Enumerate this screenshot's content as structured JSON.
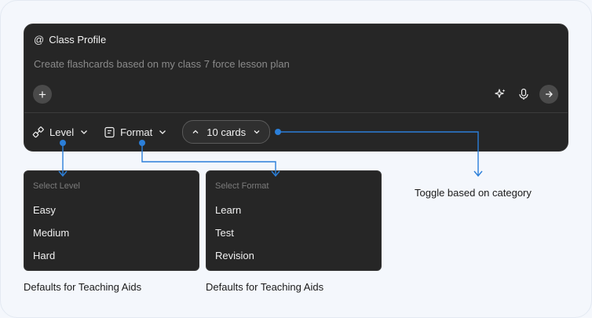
{
  "composer": {
    "profile_label": "Class Profile",
    "prompt_text": "Create flashcards based on my class 7 force lesson plan"
  },
  "toolbar": {
    "level_label": "Level",
    "format_label": "Format",
    "cards_label": "10 cards"
  },
  "level_panel": {
    "placeholder": "Select Level",
    "options": [
      "Easy",
      "Medium",
      "Hard"
    ],
    "caption": "Defaults for Teaching Aids"
  },
  "format_panel": {
    "placeholder": "Select Format",
    "options": [
      "Learn",
      "Test",
      "Revision"
    ],
    "caption": "Defaults for Teaching Aids"
  },
  "annotations": {
    "toggle_caption": "Toggle based on category"
  },
  "colors": {
    "annotation_blue": "#2b7fd9",
    "composer_bg": "#262626",
    "page_bg": "#f4f7fc"
  }
}
